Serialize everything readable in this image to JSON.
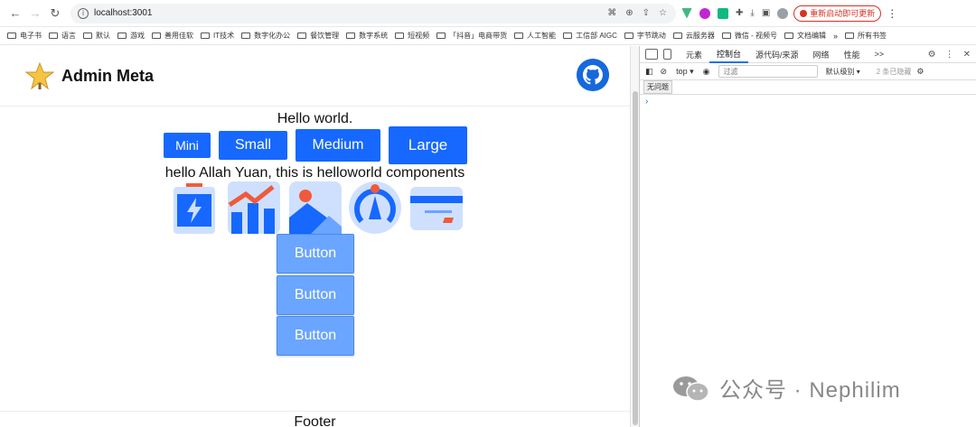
{
  "browser": {
    "url": "localhost:3001",
    "restart_label": "重新启动即可更新",
    "bookmarks": [
      "电子书",
      "语言",
      "默认",
      "游戏",
      "善用佳软",
      "IT技术",
      "数字化办公",
      "餐饮管理",
      "数字系统",
      "短视频",
      "「抖音」电商带货",
      "人工智能",
      "工信部 AIGC",
      "字节跳动",
      "云服务器",
      "微信 - 视频号",
      "文档编辑"
    ],
    "bookmarks_more": "»",
    "bookmarks_all": "所有书签"
  },
  "app": {
    "title": "Admin Meta",
    "hello": "Hello world.",
    "greeting": "hello Allah Yuan, this is helloworld components",
    "size_buttons": [
      "Mini",
      "Small",
      "Medium",
      "Large"
    ],
    "stack_buttons": [
      "Button",
      "Button",
      "Button"
    ],
    "footer": "Footer",
    "icons": [
      "battery-bolt-icon",
      "chart-trend-icon",
      "image-icon",
      "gauge-icon",
      "credit-card-icon"
    ],
    "accent": "#1668ff",
    "light_accent": "#6aa5ff"
  },
  "devtools": {
    "tabs": [
      "元素",
      "控制台",
      "源代码/来源",
      "网络",
      "性能"
    ],
    "active_tab": "控制台",
    "more": ">>",
    "context": "top",
    "filter_placeholder": "过滤",
    "level": "默认级别",
    "hidden": "2 条已隐藏",
    "issues": "无问题",
    "prompt": "›"
  },
  "watermark": "公众号 · Nephilim"
}
